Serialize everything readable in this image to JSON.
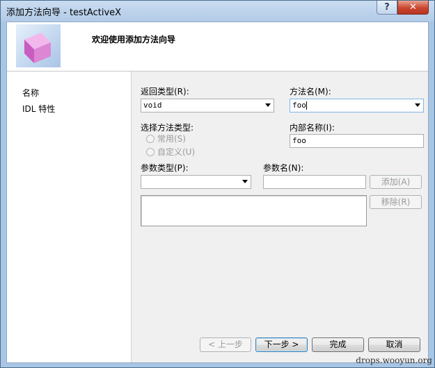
{
  "window": {
    "title": "添加方法向导 - testActiveX",
    "help_glyph": "?",
    "close_glyph": "✕"
  },
  "header": {
    "title": "欢迎使用添加方法向导",
    "logo_icon": "wizard-cube-icon"
  },
  "nav": {
    "items": [
      {
        "label": "名称"
      },
      {
        "label": "IDL 特性"
      }
    ]
  },
  "form": {
    "return_type": {
      "label": "返回类型(R):",
      "value": "void"
    },
    "method_name": {
      "label": "方法名(M):",
      "value": "foo"
    },
    "method_type": {
      "label": "选择方法类型:",
      "options": [
        {
          "label": "常用(S)",
          "selected": false
        },
        {
          "label": "自定义(U)",
          "selected": false
        }
      ]
    },
    "internal_name": {
      "label": "内部名称(I):",
      "value": "foo"
    },
    "param_type": {
      "label": "参数类型(P):",
      "value": ""
    },
    "param_name": {
      "label": "参数名(N):",
      "value": ""
    },
    "add_button": "添加(A)",
    "remove_button": "移除(R)"
  },
  "footer": {
    "prev": "< 上一步",
    "next": "下一步 >",
    "finish": "完成",
    "cancel": "取消"
  },
  "watermark": "drops.wooyun.org"
}
